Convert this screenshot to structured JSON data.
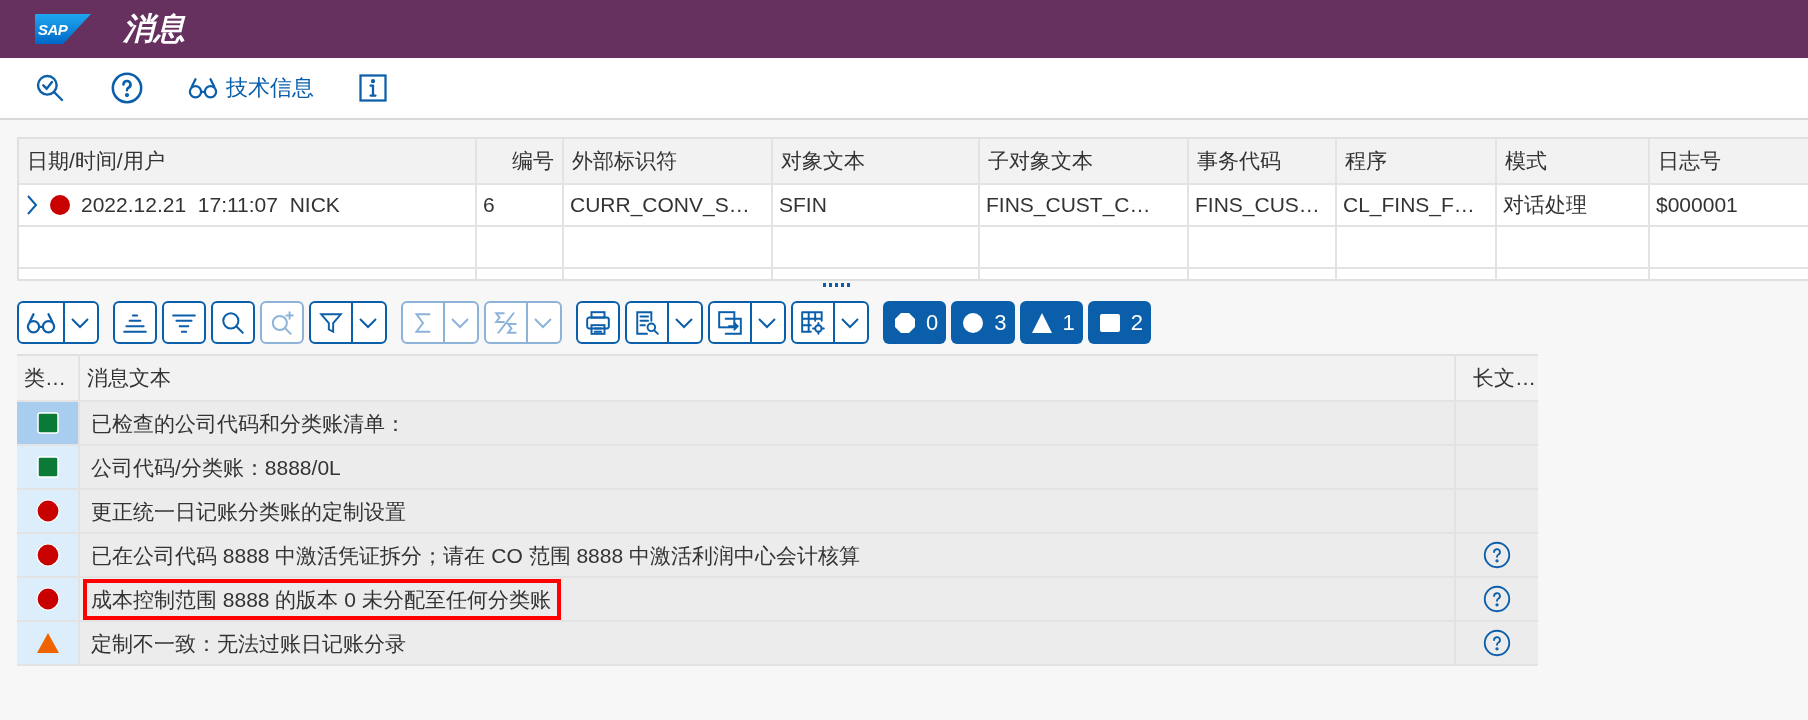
{
  "header": {
    "logo": "SAP",
    "title": "消息"
  },
  "toolbar": [
    {
      "kind": "check-search"
    },
    {
      "kind": "help"
    },
    {
      "kind": "glasses",
      "label": "技术信息"
    },
    {
      "kind": "info"
    }
  ],
  "log_table": {
    "columns": [
      "日期/时间/用户",
      "编号",
      "外部标识符",
      "对象文本",
      "子对象文本",
      "事务代码",
      "程序",
      "模式",
      "日志号"
    ],
    "rows": [
      {
        "expanded": false,
        "kind": "error",
        "cells": [
          "2022.12.21  17:11:07  NICK",
          "6",
          "CURR_CONV_S…",
          "SFIN",
          "FINS_CUST_C…",
          "FINS_CUS…",
          "CL_FINS_F…",
          "对话处理",
          "$000001"
        ]
      }
    ]
  },
  "message_toolbar": {
    "groups": [
      [
        {
          "kind": "glasses",
          "menu": true,
          "disabled": false
        }
      ],
      [
        {
          "kind": "sort-up",
          "menu": false,
          "disabled": false
        },
        {
          "kind": "sort-down",
          "menu": false,
          "disabled": false
        },
        {
          "kind": "search",
          "menu": false,
          "disabled": false
        },
        {
          "kind": "search-plus",
          "menu": false,
          "disabled": true
        },
        {
          "kind": "filter",
          "menu": true,
          "disabled": false
        }
      ],
      [
        {
          "kind": "sigma",
          "menu": true,
          "disabled": true
        },
        {
          "kind": "subtotal",
          "menu": true,
          "disabled": true
        }
      ],
      [
        {
          "kind": "print",
          "menu": false,
          "disabled": false
        },
        {
          "kind": "preview",
          "menu": true,
          "disabled": false
        },
        {
          "kind": "export",
          "menu": true,
          "disabled": false
        },
        {
          "kind": "layout",
          "menu": true,
          "disabled": false
        }
      ]
    ],
    "counters": [
      {
        "kind": "stop",
        "count": "0"
      },
      {
        "kind": "error",
        "count": "3"
      },
      {
        "kind": "warning",
        "count": "1"
      },
      {
        "kind": "info",
        "count": "2"
      }
    ]
  },
  "messages": {
    "columns": [
      "类…",
      "消息文本",
      "长文…"
    ],
    "rows": [
      {
        "kind": "success",
        "selected": true,
        "text": "已检查的公司代码和分类账清单：",
        "long_text": false,
        "highlighted": false
      },
      {
        "kind": "success",
        "selected": false,
        "text": "公司代码/分类账：8888/0L",
        "long_text": false,
        "highlighted": false
      },
      {
        "kind": "error",
        "selected": false,
        "text": "更正统一日记账分类账的定制设置",
        "long_text": false,
        "highlighted": false
      },
      {
        "kind": "error",
        "selected": false,
        "text": "已在公司代码 8888 中激活凭证拆分；请在 CO 范围 8888 中激活利润中心会计核算",
        "long_text": true,
        "highlighted": false
      },
      {
        "kind": "error",
        "selected": false,
        "text": "成本控制范围 8888 的版本 0 未分配至任何分类账",
        "long_text": true,
        "highlighted": true
      },
      {
        "kind": "warning",
        "selected": false,
        "text": "定制不一致：无法过账日记账分录",
        "long_text": true,
        "highlighted": false
      }
    ]
  }
}
